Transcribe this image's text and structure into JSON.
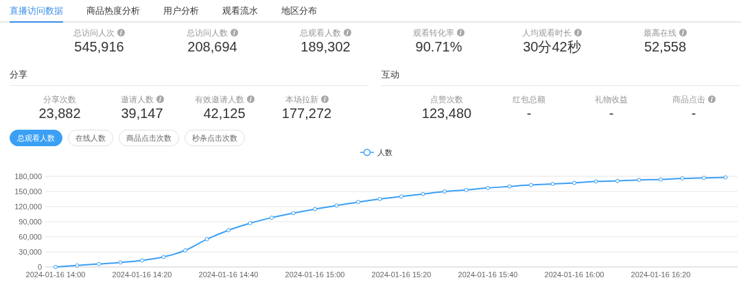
{
  "tabs": [
    {
      "label": "直播访问数据",
      "selected": true
    },
    {
      "label": "商品热度分析",
      "selected": false
    },
    {
      "label": "用户分析",
      "selected": false
    },
    {
      "label": "观看流水",
      "selected": false
    },
    {
      "label": "地区分布",
      "selected": false
    }
  ],
  "overview": [
    {
      "label": "总访问人次",
      "info": true,
      "value": "545,916"
    },
    {
      "label": "总访问人数",
      "info": true,
      "value": "208,694"
    },
    {
      "label": "总观看人数",
      "info": true,
      "value": "189,302"
    },
    {
      "label": "观看转化率",
      "info": true,
      "value": "90.71%"
    },
    {
      "label": "人均观看时长",
      "info": true,
      "value": "30分42秒"
    },
    {
      "label": "最高在线",
      "info": true,
      "value": "52,558"
    }
  ],
  "sections": [
    {
      "title": "分享",
      "stats": [
        {
          "label": "分享次数",
          "info": false,
          "value": "23,882"
        },
        {
          "label": "邀请人数",
          "info": true,
          "value": "39,147"
        },
        {
          "label": "有效邀请人数",
          "info": true,
          "value": "42,125"
        },
        {
          "label": "本场拉新",
          "info": true,
          "value": "177,272"
        }
      ]
    },
    {
      "title": "互动",
      "stats": [
        {
          "label": "点赞次数",
          "info": false,
          "value": "123,480"
        },
        {
          "label": "红包总额",
          "info": false,
          "value": "-"
        },
        {
          "label": "礼物收益",
          "info": false,
          "value": "-"
        },
        {
          "label": "商品点击",
          "info": true,
          "value": "-"
        }
      ]
    }
  ],
  "metric_pills": [
    {
      "label": "总观看人数",
      "selected": true
    },
    {
      "label": "在线人数",
      "selected": false
    },
    {
      "label": "商品点击次数",
      "selected": false
    },
    {
      "label": "秒杀点击次数",
      "selected": false
    }
  ],
  "chart": {
    "chart_data": {
      "type": "line",
      "grid": true,
      "categories": [
        "2024-01-16 14:00",
        null,
        null,
        null,
        "2024-01-16 14:20",
        null,
        null,
        null,
        "2024-01-16 14:40",
        null,
        null,
        null,
        "2024-01-16 15:00",
        null,
        null,
        null,
        "2024-01-16 15:20",
        null,
        null,
        null,
        "2024-01-16 15:40",
        null,
        null,
        null,
        "2024-01-16 16:00",
        null,
        null,
        null,
        "2024-01-16 16:20",
        null,
        null,
        null
      ],
      "series": [
        {
          "name": "人数",
          "color": "#3a9ff5",
          "marker": "circle",
          "values": [
            0,
            3000,
            6000,
            9000,
            13000,
            20000,
            33000,
            55000,
            73000,
            87000,
            98000,
            107000,
            115000,
            122000,
            129000,
            135000,
            140000,
            145000,
            150000,
            153000,
            157000,
            160000,
            163000,
            165000,
            167000,
            170000,
            171000,
            173000,
            174000,
            176000,
            177000,
            178000
          ]
        }
      ],
      "ylim": [
        0,
        180000
      ],
      "yticks": [
        {
          "value": 0,
          "label": "0"
        },
        {
          "value": 30000,
          "label": "30,000"
        },
        {
          "value": 60000,
          "label": "60,000"
        },
        {
          "value": 90000,
          "label": "90,000"
        },
        {
          "value": 120000,
          "label": "120,000"
        },
        {
          "value": 150000,
          "label": "150,000"
        },
        {
          "value": 180000,
          "label": "180,000"
        }
      ]
    }
  }
}
